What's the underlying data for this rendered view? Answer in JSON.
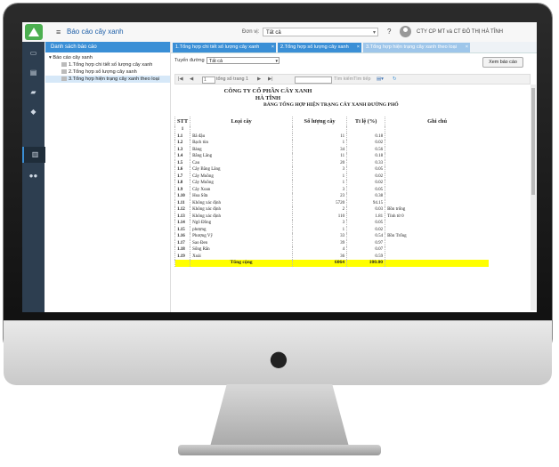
{
  "app": {
    "title": "Báo cáo cây xanh",
    "menu_icon": "hamburger-icon"
  },
  "header": {
    "unit_label": "Đơn vị:",
    "unit_value": "Tất cả",
    "help": "?",
    "org": "CTY CP MT và CT ĐÔ THỊ HÀ TĨNH"
  },
  "rail": [
    "monitor-icon",
    "document-icon",
    "folder-icon",
    "tag-icon",
    "chart-icon",
    "users-icon"
  ],
  "tree": {
    "header": "Danh sách báo cáo",
    "root": "Báo cáo cây xanh",
    "items": [
      "1.Tổng hợp chi tiết số lượng cây xanh",
      "2.Tổng hợp số lượng cây xanh",
      "3.Tổng hợp hiện trạng cây xanh theo loại"
    ]
  },
  "tabs": [
    {
      "label": "1.Tổng hợp chi tiết số lượng cây xanh",
      "close": "×"
    },
    {
      "label": "2.Tổng hợp số lượng cây xanh",
      "close": "×"
    },
    {
      "label": "3.Tổng hợp hiện trạng cây xanh theo loại",
      "close": "×"
    }
  ],
  "filter": {
    "route_label": "Tuyến đường",
    "route_value": "Tất cả",
    "view_button": "Xem báo cáo"
  },
  "pager": {
    "first": "|◀",
    "prev": "◀",
    "page": "1",
    "of_label": "tổng số trang 1",
    "next": "▶",
    "last": "▶|",
    "find": "Tìm kiếm",
    "find_next": "Tìm tiếp"
  },
  "report": {
    "company": "CÔNG TY CỔ PHẦN CÂY XANH",
    "city": "HÀ TĨNH",
    "title": "BẢNG TỔNG HỢP HIỆN TRẠNG CÂY XANH ĐƯỜNG PHỐ",
    "columns": [
      "STT",
      "Loại cây",
      "Số lượng cây",
      "Tỉ lệ (%)",
      "Ghi chú"
    ],
    "group": "1",
    "rows": [
      [
        "1.1",
        "Bã đậu",
        "11",
        "0.18",
        ""
      ],
      [
        "1.2",
        "Bạch tùn",
        "1",
        "0.02",
        ""
      ],
      [
        "1.3",
        "Bàng",
        "34",
        "0.56",
        ""
      ],
      [
        "1.4",
        "Bằng Lăng",
        "11",
        "0.18",
        ""
      ],
      [
        "1.5",
        "Cau",
        "20",
        "0.33",
        ""
      ],
      [
        "1.6",
        "Cây Bằng Lăng",
        "3",
        "0.05",
        ""
      ],
      [
        "1.7",
        "Cây Muồng",
        "1",
        "0.02",
        ""
      ],
      [
        "1.8",
        "Cây Muồng",
        "1",
        "0.02",
        ""
      ],
      [
        "1.9",
        "Cây Xoan",
        "3",
        "0.05",
        ""
      ],
      [
        "1.10",
        "Hoa Sữa",
        "23",
        "0.38",
        ""
      ],
      [
        "1.11",
        "Không xác định",
        "5720",
        "94.15",
        ""
      ],
      [
        "1.12",
        "Không xác định",
        "2",
        "0.03",
        "Bồn trống"
      ],
      [
        "1.13",
        "Không xác định",
        "110",
        "1.81",
        "Tính từ 0"
      ],
      [
        "1.14",
        "Ngô Đồng",
        "3",
        "0.05",
        ""
      ],
      [
        "1.15",
        "phượng",
        "1",
        "0.02",
        ""
      ],
      [
        "1.16",
        "Phượng Vỹ",
        "33",
        "0.54",
        "Bồn Trống"
      ],
      [
        "1.17",
        "Sao Đen",
        "39",
        "0.97",
        ""
      ],
      [
        "1.18",
        "Sống Rắn",
        "4",
        "0.07",
        ""
      ],
      [
        "1.19",
        "Xoài",
        "36",
        "0.59",
        ""
      ]
    ],
    "total": {
      "label": "Tổng cộng",
      "count": "6064",
      "percent": "100.00"
    }
  },
  "colors": {
    "accent": "#3a8fd6",
    "rail": "#2d3e50",
    "total_row": "#ffff00"
  }
}
